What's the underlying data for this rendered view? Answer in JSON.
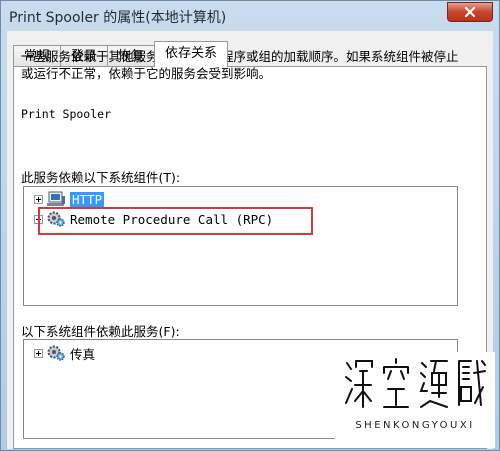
{
  "window": {
    "title": "Print Spooler 的属性(本地计算机)"
  },
  "tabs": [
    {
      "label": "常规",
      "active": false
    },
    {
      "label": "登录",
      "active": false
    },
    {
      "label": "恢复",
      "active": false
    },
    {
      "label": "依存关系",
      "active": true
    }
  ],
  "dependencies": {
    "description": "一些服务依赖于其他服务、系统驱动程序或组的加载顺序。如果系统组件被停止或运行不正常，依赖于它的服务会受到影响。",
    "service_name": "Print Spooler",
    "depends_on_label": "此服务依赖以下系统组件(T):",
    "depends_on_items": [
      {
        "label": "HTTP",
        "icon": "driver-icon",
        "selected": true
      },
      {
        "label": "Remote Procedure Call (RPC)",
        "icon": "service-gear-icon",
        "selected": false
      }
    ],
    "dependents_label": "以下系统组件依赖此服务(F):",
    "dependents_items": [
      {
        "label": "传真",
        "icon": "service-gear-icon",
        "selected": false
      }
    ]
  },
  "watermark": {
    "text": "深空游戏",
    "subtext": "SHENKONGYOUXI"
  },
  "colors": {
    "highlight": "#d43a3a",
    "selection": "#3399ff",
    "close_button": "#c7452a"
  }
}
